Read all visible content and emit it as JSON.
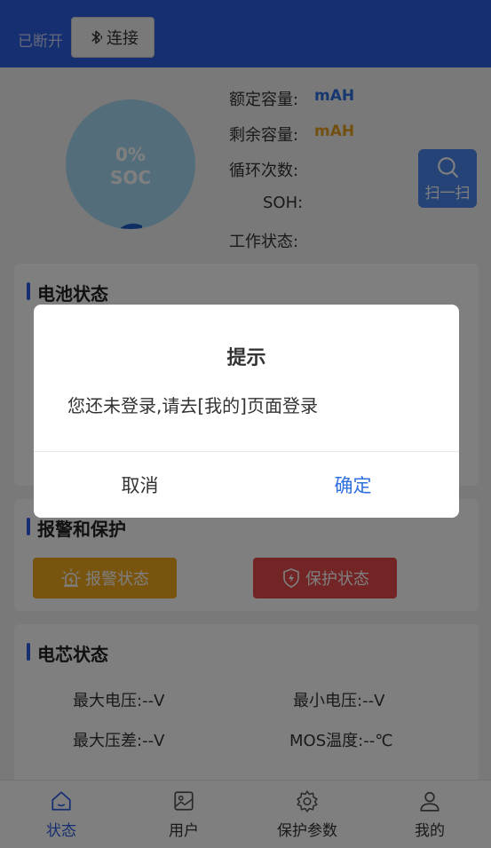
{
  "header": {
    "status": "已断开",
    "connect_label": "连接",
    "bg_color": "#2d5ee0"
  },
  "soc": {
    "percent": "0%",
    "label": "SOC",
    "level": 0
  },
  "info": {
    "rated_capacity_label": "额定容量:",
    "rated_capacity_value": "mAH",
    "remaining_capacity_label": "剩余容量:",
    "remaining_capacity_value": "mAH",
    "cycle_count_label": "循环次数:",
    "soh_label": "SOH:",
    "work_status_label": "工作状态:",
    "rated_color": "#2d6fe0",
    "remaining_color": "#e8a020"
  },
  "scan": {
    "label": "扫一扫"
  },
  "battery_card": {
    "title": "电池状态"
  },
  "alarm_card": {
    "title": "报警和保护",
    "alarm_label": "报警状态",
    "protect_label": "保护状态",
    "alarm_color": "#f0a81e",
    "protect_color": "#e64848"
  },
  "cell_card": {
    "title": "电芯状态",
    "max_voltage_label": "最大电压:",
    "max_voltage_value": "--V",
    "min_voltage_label": "最小电压:",
    "min_voltage_value": "--V",
    "max_diff_label": "最大压差:",
    "max_diff_value": "--V",
    "mos_temp_label": "MOS温度:",
    "mos_temp_value": "--℃"
  },
  "tabs": [
    {
      "label": "状态",
      "icon": "home-icon",
      "active": true
    },
    {
      "label": "用户",
      "icon": "image-icon",
      "active": false
    },
    {
      "label": "保护参数",
      "icon": "gear-icon",
      "active": false
    },
    {
      "label": "我的",
      "icon": "user-icon",
      "active": false
    }
  ],
  "dialog": {
    "title": "提示",
    "message": "您还未登录,请去[我的]页面登录",
    "cancel_label": "取消",
    "confirm_label": "确定"
  }
}
